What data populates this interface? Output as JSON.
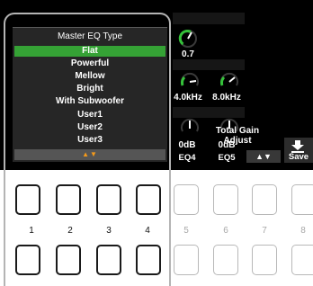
{
  "popup": {
    "title": "Master EQ Type",
    "items": [
      "Flat",
      "Powerful",
      "Mellow",
      "Bright",
      "With Subwoofer",
      "User1",
      "User2",
      "User3"
    ],
    "selected_index": 0,
    "scroll_arrows": "▲▼"
  },
  "eq_knobs": {
    "top_value": "0.7",
    "freq_values": [
      "4.0kHz",
      "8.0kHz"
    ],
    "gain_values": [
      "0dB",
      "0dB"
    ],
    "band_names": [
      "EQ4",
      "EQ5"
    ]
  },
  "total_gain": {
    "label_line1": "Total Gain",
    "label_line2": "Adjust",
    "arrows": "▲▼"
  },
  "save": {
    "label": "Save",
    "icon": "save-download-icon"
  },
  "panel_buttons": {
    "upper_count": 8,
    "lower_count": 8,
    "numbers": [
      "1",
      "2",
      "3",
      "4",
      "5",
      "6",
      "7",
      "8"
    ],
    "highlighted": [
      1,
      2,
      3,
      4
    ]
  },
  "colors": {
    "selected_item": "#35a235",
    "knob_indicator": "#35c23a",
    "arrow_accent": "#f59a1a",
    "screen_bg": "#000000"
  }
}
